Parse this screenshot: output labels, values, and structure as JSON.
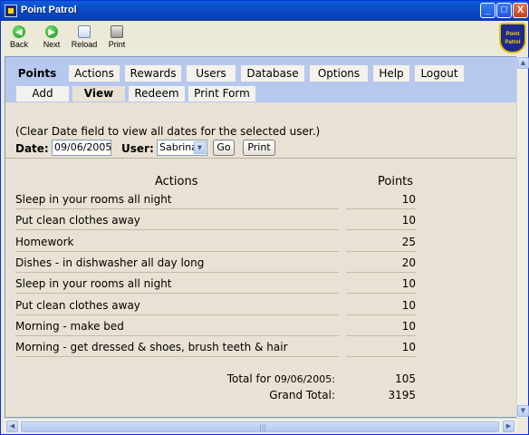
{
  "window": {
    "title": "Point Patrol",
    "buttons": {
      "minimize": "_",
      "maximize": "□",
      "close": "X"
    }
  },
  "toolbar": {
    "back": "Back",
    "next": "Next",
    "reload": "Reload",
    "print": "Print",
    "logo_line1": "Point",
    "logo_line2": "Patrol"
  },
  "nav": {
    "tabs": [
      "Points",
      "Actions",
      "Rewards",
      "Users",
      "Database",
      "Options",
      "Help",
      "Logout"
    ],
    "active_tab": "Points",
    "subtabs": [
      "Add",
      "View",
      "Redeem",
      "Print Form"
    ],
    "active_subtab": "View"
  },
  "form": {
    "note": "(Clear Date field to view all dates for the selected user.)",
    "date_label": "Date:",
    "date_value": "09/06/2005",
    "user_label": "User:",
    "user_selected": "Sabrina",
    "go_label": "Go",
    "print_label": "Print"
  },
  "table": {
    "headers": {
      "actions": "Actions",
      "points": "Points"
    },
    "rows": [
      {
        "action": "Sleep in your rooms all night",
        "points": "10"
      },
      {
        "action": "Put clean clothes away",
        "points": "10"
      },
      {
        "action": "Homework",
        "points": "25"
      },
      {
        "action": "Dishes - in dishwasher all day long",
        "points": "20"
      },
      {
        "action": "Sleep in your rooms all night",
        "points": "10"
      },
      {
        "action": "Put clean clothes away",
        "points": "10"
      },
      {
        "action": "Morning - make bed",
        "points": "10"
      },
      {
        "action": "Morning - get dressed & shoes, brush teeth & hair",
        "points": "10"
      }
    ]
  },
  "totals": {
    "total_prefix": "Total for",
    "total_date": "09/06/2005:",
    "total_value": "105",
    "grand_label": "Grand Total:",
    "grand_value": "3195"
  },
  "colors": {
    "nav_bar": "#b7c8ee",
    "content_bg": "#e9e1d3",
    "titlebar": "#0a4cc4"
  }
}
